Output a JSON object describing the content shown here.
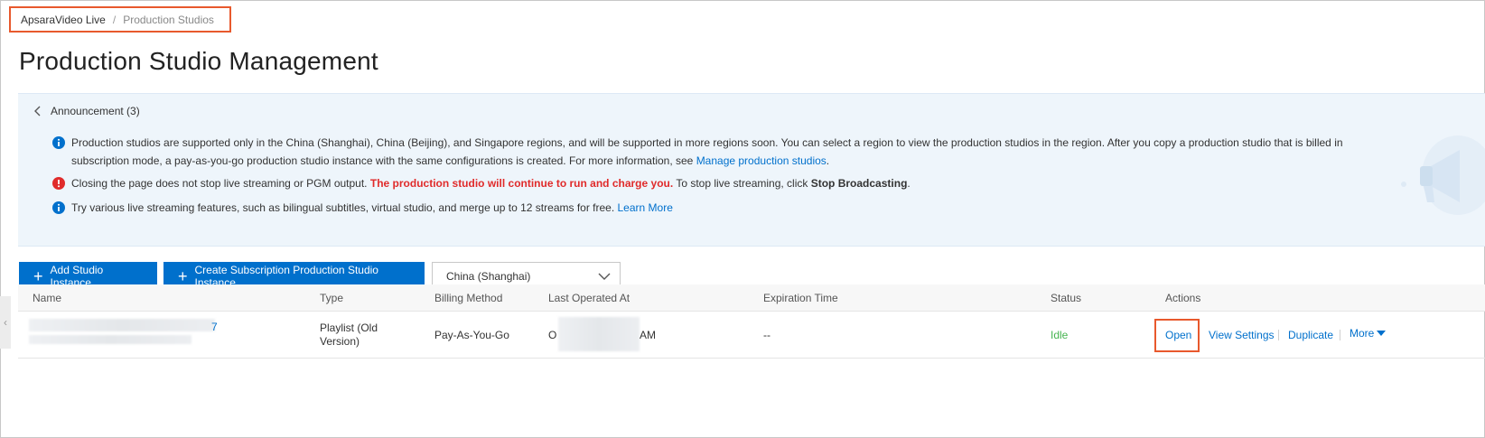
{
  "breadcrumb": {
    "root": "ApsaraVideo Live",
    "separator": "/",
    "current": "Production Studios"
  },
  "page_title": "Production Studio Management",
  "announcement": {
    "title": "Announcement (3)",
    "notes": [
      {
        "icon": "info-icon",
        "text_1": "Production studios are supported only in the China (Shanghai), China (Beijing), and Singapore regions, and will be supported in more regions soon. You can select a region to view the production studios in the region. After you copy a production studio that is billed in subscription mode, a pay-as-you-go production studio instance with the same configurations is created. For more information, see ",
        "link": "Manage production studios",
        "text_2": "."
      },
      {
        "icon": "error-icon",
        "text_1": "Closing the page does not stop live streaming or PGM output. ",
        "warning": "The production studio will continue to run and charge you.",
        "text_2": " To stop live streaming, click ",
        "bold": "Stop Broadcasting",
        "text_3": "."
      },
      {
        "icon": "info-icon",
        "text_1": "Try various live streaming features, such as bilingual subtitles, virtual studio, and merge up to 12 streams for free. ",
        "link": "Learn More"
      }
    ]
  },
  "toolbar": {
    "add_label": "Add Studio Instance",
    "create_sub_label": "Create Subscription Production Studio Instance",
    "region_value": "China (Shanghai)"
  },
  "table": {
    "headers": [
      "Name",
      "Type",
      "Billing Method",
      "Last Operated At",
      "Expiration Time",
      "Status",
      "Actions"
    ],
    "rows": [
      {
        "name_suffix": "7",
        "type": "Playlist (Old Version)",
        "billing": "Pay-As-You-Go",
        "last_prefix": "O",
        "last_suffix": "AM",
        "expiration": "--",
        "status": "Idle",
        "actions": {
          "open": "Open",
          "settings": "View Settings",
          "duplicate": "Duplicate",
          "more": "More"
        }
      }
    ]
  },
  "colors": {
    "primary": "#0070cc",
    "highlight_border": "#e8592d",
    "status_idle": "#46b450",
    "warning": "#e02b2b"
  }
}
